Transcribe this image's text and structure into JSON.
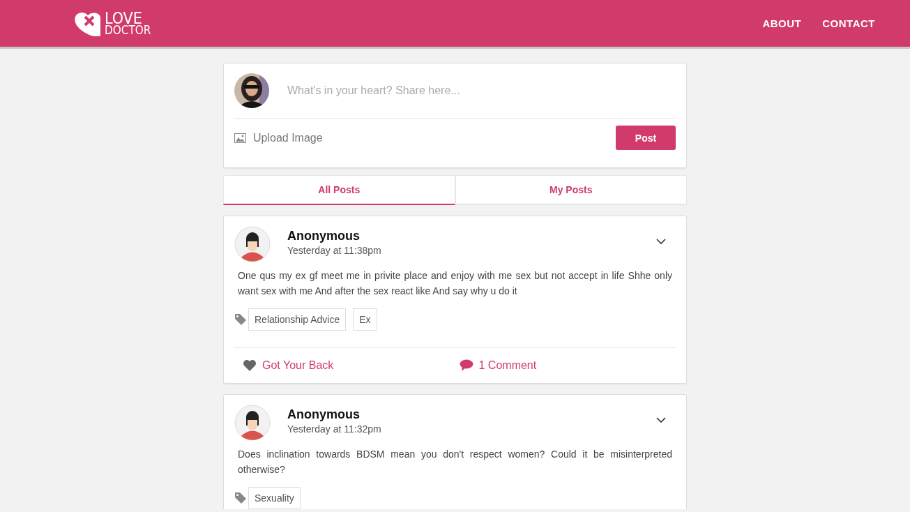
{
  "header": {
    "logo": {
      "line1": "LOVE",
      "line2": "DOCTOR"
    },
    "nav": [
      "ABOUT",
      "CONTACT"
    ]
  },
  "composer": {
    "placeholder": "What's in your heart? Share here...",
    "upload_label": "Upload Image",
    "post_button": "Post"
  },
  "tabs": [
    {
      "label": "All Posts",
      "selected": true
    },
    {
      "label": "My Posts",
      "selected": false
    }
  ],
  "posts": [
    {
      "author": "Anonymous",
      "time": "Yesterday at 11:38pm",
      "body": "One qus my ex gf meet me in privite place and enjoy with me sex but not accept in life Shhe only want sex with me And after the sex react like And say why u do it",
      "tags": [
        "Relationship Advice",
        "Ex"
      ],
      "actions": {
        "support": "Got Your Back",
        "comments": "1 Comment"
      }
    },
    {
      "author": "Anonymous",
      "time": "Yesterday at 11:32pm",
      "body": "Does inclination towards BDSM mean you don't respect women? Could it be misinterpreted otherwise?",
      "tags": [
        "Sexuality"
      ]
    }
  ]
}
